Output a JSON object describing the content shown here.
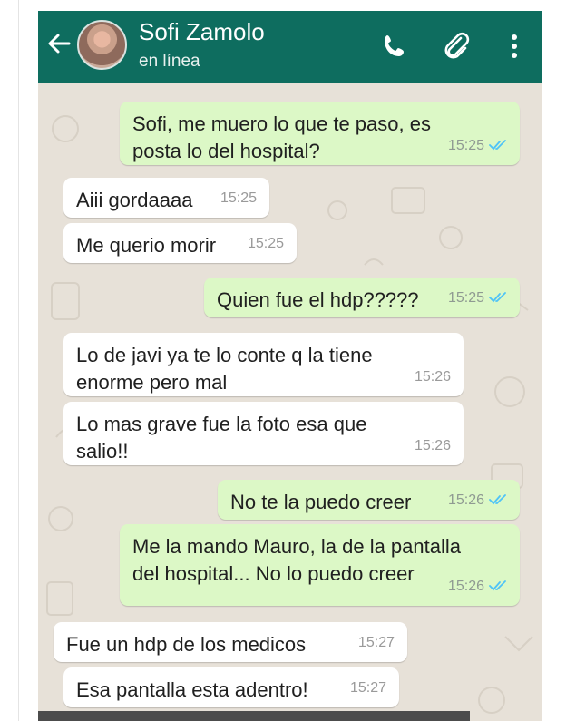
{
  "header": {
    "contact_name": "Sofi Zamolo",
    "status": "en línea"
  },
  "icons": {
    "back": "arrow-left-icon",
    "call": "phone-icon",
    "attach": "paperclip-icon",
    "menu": "more-vertical-icon",
    "read_receipt": "double-check-icon"
  },
  "colors": {
    "header": "#0e6d5f",
    "outgoing_bubble": "#dcf8c6",
    "incoming_bubble": "#ffffff",
    "read_tick": "#4fc3f7",
    "wallpaper": "#e7e1d8"
  },
  "messages": [
    {
      "dir": "out",
      "text": "Sofi, me muero lo que te paso, es\nposta lo del hospital?",
      "time": "15:25",
      "read": true
    },
    {
      "dir": "in",
      "text": "Aiii gordaaaa",
      "time": "15:25"
    },
    {
      "dir": "in",
      "text": "Me querio morir",
      "time": "15:25"
    },
    {
      "dir": "out",
      "text": "Quien fue el hdp?????",
      "time": "15:25",
      "read": true
    },
    {
      "dir": "in",
      "text": "Lo de javi ya te lo conte q la tiene\nenorme pero mal",
      "time": "15:26"
    },
    {
      "dir": "in",
      "text": "Lo mas grave fue la foto esa que\nsalio!!",
      "time": "15:26"
    },
    {
      "dir": "out",
      "text": "No te la puedo creer",
      "time": "15:26",
      "read": true
    },
    {
      "dir": "out",
      "text": "Me la mando Mauro, la de la pantalla\ndel hospital... No lo puedo creer",
      "time": "15:26",
      "read": true
    },
    {
      "dir": "in",
      "text": "Fue un hdp de los medicos",
      "time": "15:27"
    },
    {
      "dir": "in",
      "text": "Esa pantalla esta adentro!",
      "time": "15:27"
    }
  ]
}
